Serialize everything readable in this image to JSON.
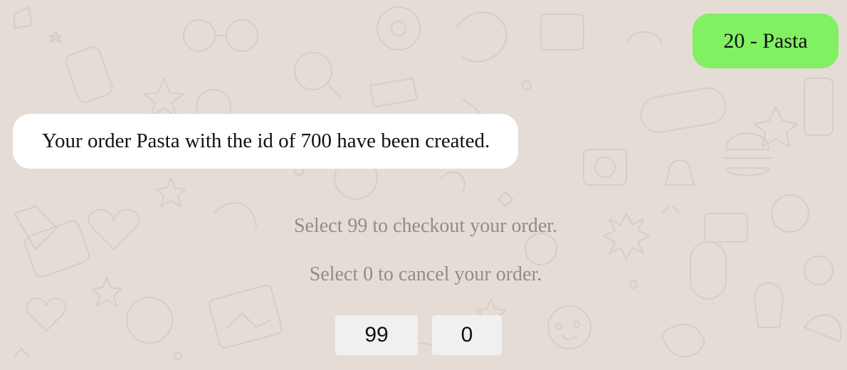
{
  "chat": {
    "sent_message": "20 - Pasta",
    "received_message": "Your order Pasta with the id of 700 have been created.",
    "instructions": [
      "Select 99 to checkout your order.",
      "Select 0 to cancel your order."
    ],
    "options": [
      "99",
      "0"
    ]
  },
  "colors": {
    "background": "#e5ddd5",
    "sent_bubble": "#81f063",
    "received_bubble": "#ffffff",
    "instruction_text": "#8d8d8d",
    "option_button": "#f0f0f0"
  },
  "background_pattern": "chat-doodle-wallpaper"
}
